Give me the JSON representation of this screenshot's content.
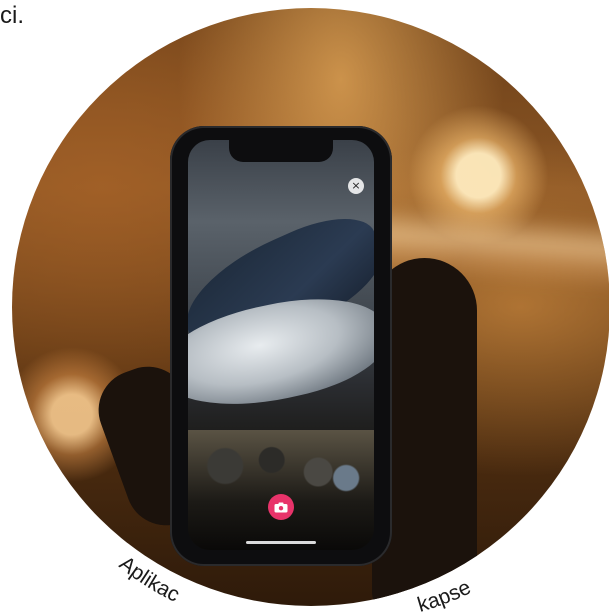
{
  "top_fragment": "ci.",
  "caption_arc": {
    "left": "Aplikac",
    "right": "kapse"
  },
  "phone_ui": {
    "close_glyph": "×",
    "camera_icon": "camera-icon"
  },
  "colors": {
    "camera_button": "#e8336a",
    "caption_text": "#1a1a1a"
  }
}
